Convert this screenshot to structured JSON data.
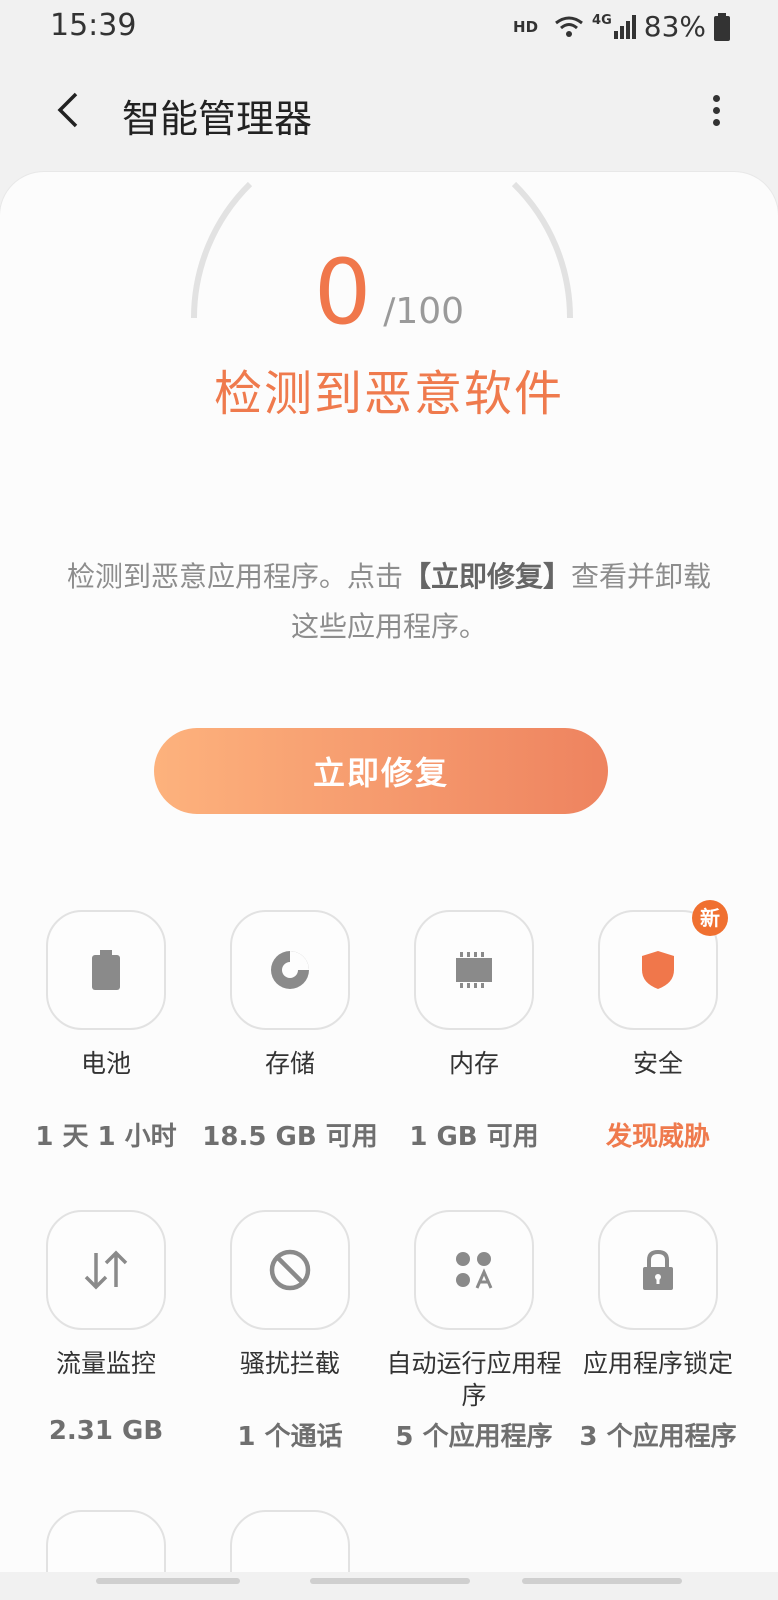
{
  "status_bar": {
    "time": "15:39",
    "network": "HD",
    "signal": "4G",
    "battery": "83%"
  },
  "header": {
    "title": "智能管理器"
  },
  "score": {
    "value": "0",
    "max": "/100",
    "status": "检测到恶意软件"
  },
  "description": {
    "prefix": "检测到恶意应用程序。点击",
    "highlight": "【立即修复】",
    "suffix": "查看并卸载这些应用程序。"
  },
  "fix_button": {
    "label": "立即修复"
  },
  "tiles": [
    {
      "label": "电池",
      "value": "1 天 1 小时"
    },
    {
      "label": "存储",
      "value": "18.5 GB 可用"
    },
    {
      "label": "内存",
      "value": "1 GB 可用"
    },
    {
      "label": "安全",
      "value": "发现威胁",
      "badge": "新"
    },
    {
      "label": "流量监控",
      "value": "2.31 GB"
    },
    {
      "label": "骚扰拦截",
      "value": "1 个通话"
    },
    {
      "label": "自动运行应用程序",
      "value": "5 个应用程序"
    },
    {
      "label": "应用程序锁定",
      "value": "3 个应用程序"
    }
  ],
  "colors": {
    "accent": "#f0774b",
    "icon_gray": "#8a8a8a"
  }
}
